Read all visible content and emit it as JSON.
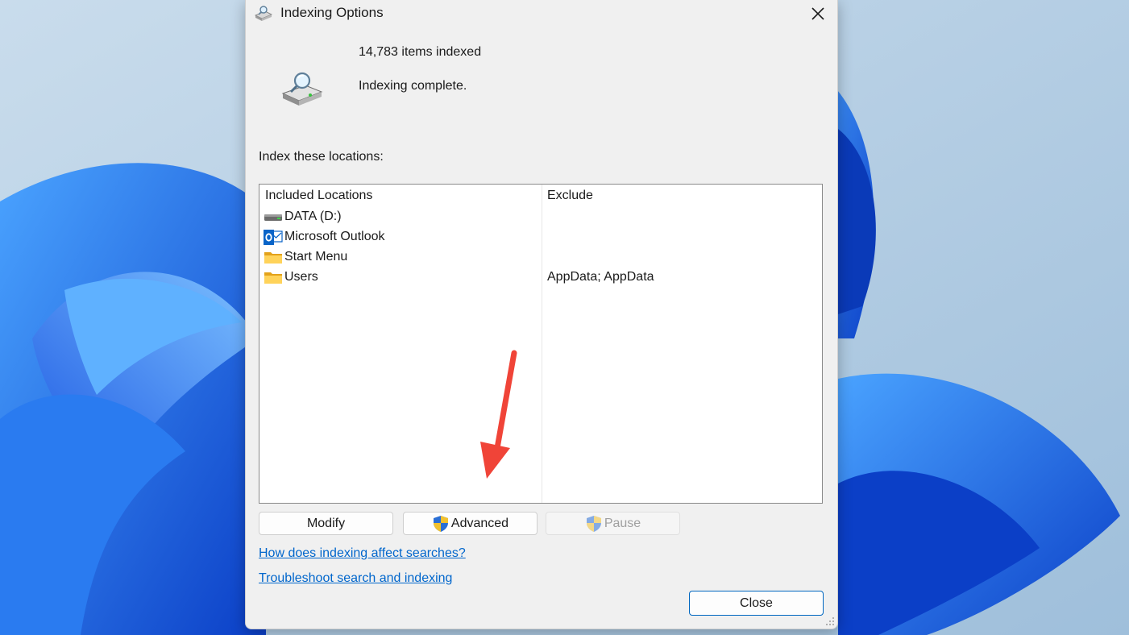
{
  "dialog": {
    "title": "Indexing Options",
    "icons": {
      "title": "indexing-magnifier-drive-icon",
      "summary": "indexing-magnifier-drive-icon",
      "close": "close-icon"
    }
  },
  "summary": {
    "items_indexed": "14,783 items indexed",
    "status": "Indexing complete."
  },
  "locations": {
    "label": "Index these locations:",
    "columns": {
      "included": "Included Locations",
      "exclude": "Exclude"
    },
    "rows": [
      {
        "name": "DATA (D:)",
        "exclude": "",
        "icon": "drive-icon"
      },
      {
        "name": "Microsoft Outlook",
        "exclude": "",
        "icon": "outlook-icon"
      },
      {
        "name": "Start Menu",
        "exclude": "",
        "icon": "folder-icon"
      },
      {
        "name": "Users",
        "exclude": "AppData; AppData",
        "icon": "folder-icon"
      }
    ]
  },
  "buttons": {
    "modify": "Modify",
    "advanced": "Advanced",
    "pause": "Pause",
    "close": "Close"
  },
  "links": {
    "how_indexing_affects": "How does indexing affect searches?",
    "troubleshoot": "Troubleshoot search and indexing"
  },
  "annotation": {
    "arrow_color": "#f04438"
  },
  "colors": {
    "link": "#0066cc",
    "dialog_bg": "#f0f0f0",
    "close_border": "#0067c0",
    "wallpaper_blue": "#1a6be0"
  }
}
